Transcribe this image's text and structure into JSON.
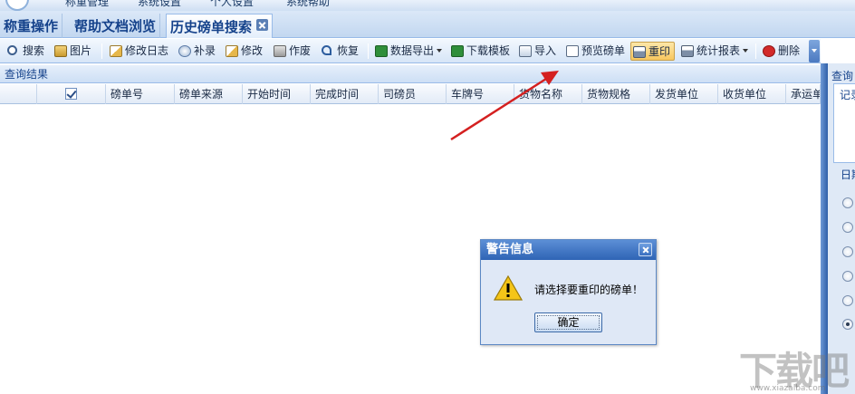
{
  "menubar": {
    "items": [
      "称重管理",
      "系统设置",
      "个人设置",
      "系统帮助"
    ]
  },
  "tabs": [
    {
      "label": "称重操作",
      "active": false
    },
    {
      "label": "帮助文档浏览",
      "active": false
    },
    {
      "label": "历史磅单搜索",
      "active": true
    }
  ],
  "toolbar": {
    "buttons": [
      {
        "label": "搜索",
        "icon": "search-icon"
      },
      {
        "label": "图片",
        "icon": "image-icon"
      },
      {
        "label": "修改日志",
        "icon": "edit-log-icon"
      },
      {
        "label": "补录",
        "icon": "add-icon"
      },
      {
        "label": "修改",
        "icon": "pencil-icon"
      },
      {
        "label": "作废",
        "icon": "trash-icon"
      },
      {
        "label": "恢复",
        "icon": "undo-icon"
      },
      {
        "label": "数据导出",
        "icon": "excel-icon"
      },
      {
        "label": "下载模板",
        "icon": "excel-icon"
      },
      {
        "label": "导入",
        "icon": "import-icon"
      },
      {
        "label": "预览磅单",
        "icon": "preview-icon"
      },
      {
        "label": "重印",
        "icon": "printer-icon"
      },
      {
        "label": "统计报表",
        "icon": "printer-icon"
      },
      {
        "label": "删除",
        "icon": "delete-icon"
      }
    ]
  },
  "results": {
    "title": "查询结果",
    "columns": [
      "磅单号",
      "磅单来源",
      "开始时间",
      "完成时间",
      "司磅员",
      "车牌号",
      "货物名称",
      "货物规格",
      "发货单位",
      "收货单位",
      "承运单"
    ],
    "select_all_checked": true,
    "rows": []
  },
  "side_panel": {
    "title": "查询",
    "record_label": "记录",
    "date_label": "日期"
  },
  "dialog": {
    "title": "警告信息",
    "message": "请选择要重印的磅单！",
    "ok_label": "确定"
  },
  "watermark": {
    "text": "下载吧",
    "url": "www.xiazaiba.com"
  },
  "colors": {
    "accent": "#15428b",
    "tab_bg": "#c2d7f0",
    "arrow": "#d42020",
    "dialog_title": "#2f64b5"
  }
}
